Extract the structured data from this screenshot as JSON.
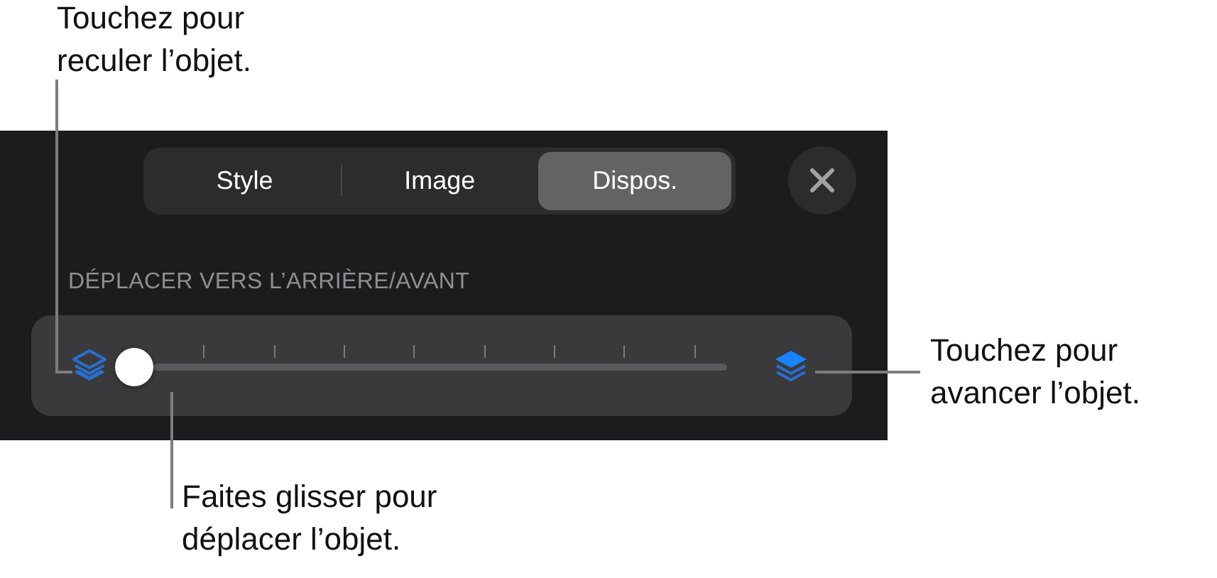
{
  "callouts": [
    {
      "kind": "back",
      "text": "Touchez pour\nreculer l’objet."
    },
    {
      "kind": "front",
      "text": "Touchez pour\navancer l’objet."
    },
    {
      "kind": "slider",
      "text": "Faites glisser pour\ndéplacer l’objet."
    }
  ],
  "tabs": [
    {
      "label": "Style",
      "selected": false
    },
    {
      "label": "Image",
      "selected": false
    },
    {
      "label": "Dispos.",
      "selected": true
    }
  ],
  "section_label": "DÉPLACER VERS L’ARRIÈRE/AVANT",
  "slider": {
    "level": 0
  }
}
